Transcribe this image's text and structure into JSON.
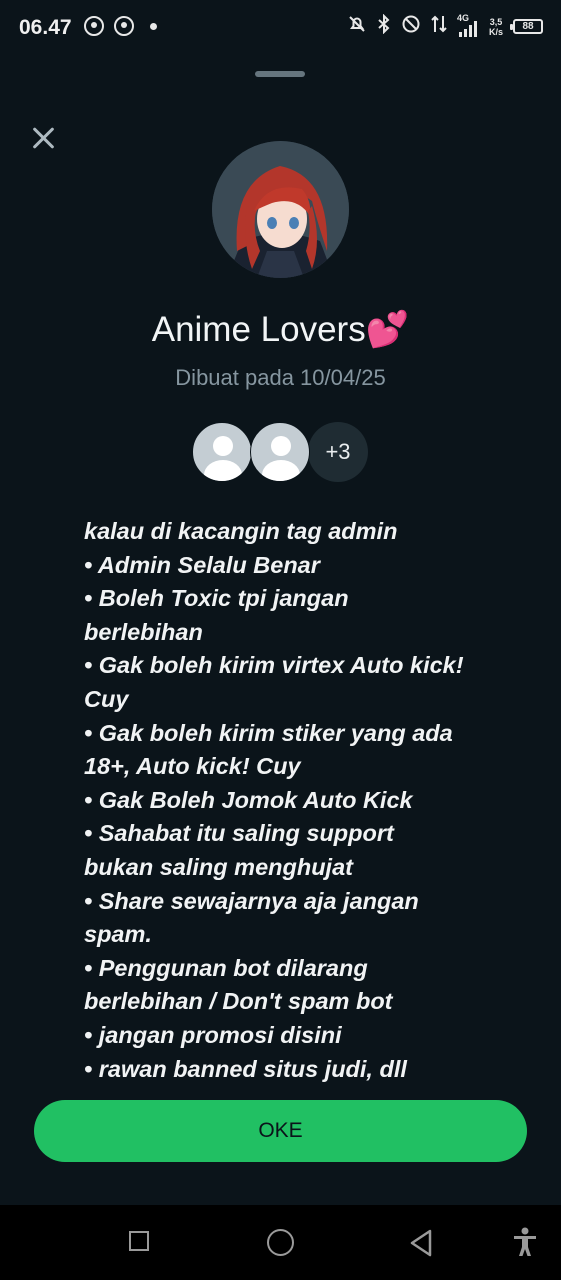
{
  "status_bar": {
    "time": "06.47",
    "speed_top": "3,5",
    "speed_bottom": "K/s",
    "network": "4G",
    "battery": "88"
  },
  "sheet": {
    "group_name": "Anime Lovers💕",
    "created_text": "Dibuat pada 10/04/25",
    "members_more": "+3",
    "description_lines": [
      "kalau di kacangin tag admin",
      "• Admin Selalu Benar",
      "• Boleh Toxic tpi jangan",
      "berlebihan",
      "• Gak boleh kirim virtex Auto kick!",
      "Cuy",
      "• Gak boleh kirim stiker yang ada",
      "18+, Auto kick! Cuy",
      "• Gak Boleh Jomok Auto Kick",
      "• Sahabat itu saling support",
      "bukan saling menghujat",
      "• Share sewajarnya aja jangan",
      "spam.",
      "• Penggunan bot dilarang",
      "berlebihan / Don't spam bot",
      "• jangan promosi disini",
      "• rawan banned situs judi, dll"
    ],
    "ok_label": "OKE"
  },
  "icons": {
    "close": "close-icon",
    "nav_recents": "square-icon",
    "nav_home": "circle-icon",
    "nav_back": "triangle-back-icon",
    "accessibility": "accessibility-icon"
  },
  "colors": {
    "background": "#0b141a",
    "accent_green": "#21c063",
    "muted_text": "#8696a0"
  }
}
